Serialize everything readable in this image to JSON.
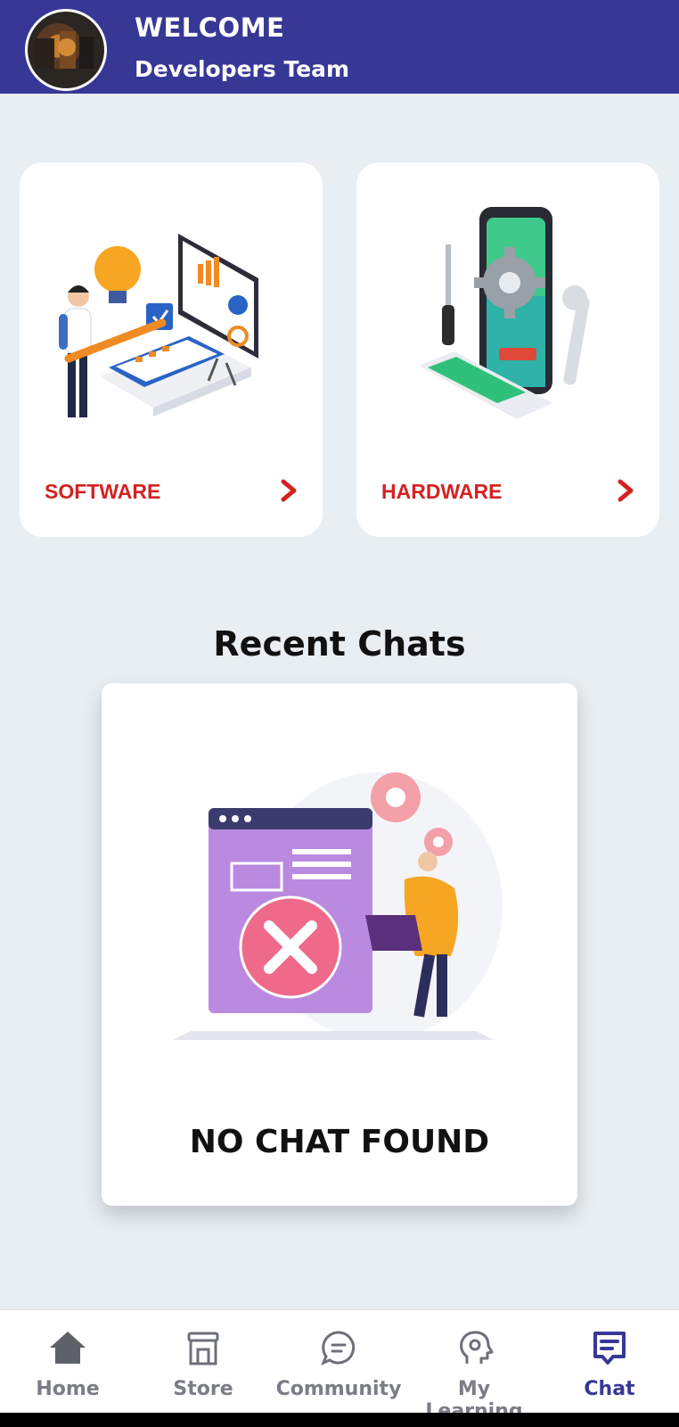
{
  "header": {
    "welcome": "WELCOME",
    "subtitle": "Developers Team"
  },
  "categories": [
    {
      "label": "SOFTWARE",
      "icon": "chevron-right-icon"
    },
    {
      "label": "HARDWARE",
      "icon": "chevron-right-icon"
    }
  ],
  "recent_chats": {
    "title": "Recent Chats",
    "empty_text": "NO CHAT FOUND"
  },
  "nav": {
    "items": [
      {
        "label": "Home",
        "icon": "home-icon"
      },
      {
        "label": "Store",
        "icon": "store-icon"
      },
      {
        "label": "Community",
        "icon": "chat-bubble-icon"
      },
      {
        "label": "My Learning",
        "icon": "head-icon"
      },
      {
        "label": "Chat",
        "icon": "message-icon",
        "active": true
      }
    ]
  },
  "colors": {
    "primary": "#373895",
    "accent_red": "#d42222",
    "background": "#e9eef3"
  }
}
